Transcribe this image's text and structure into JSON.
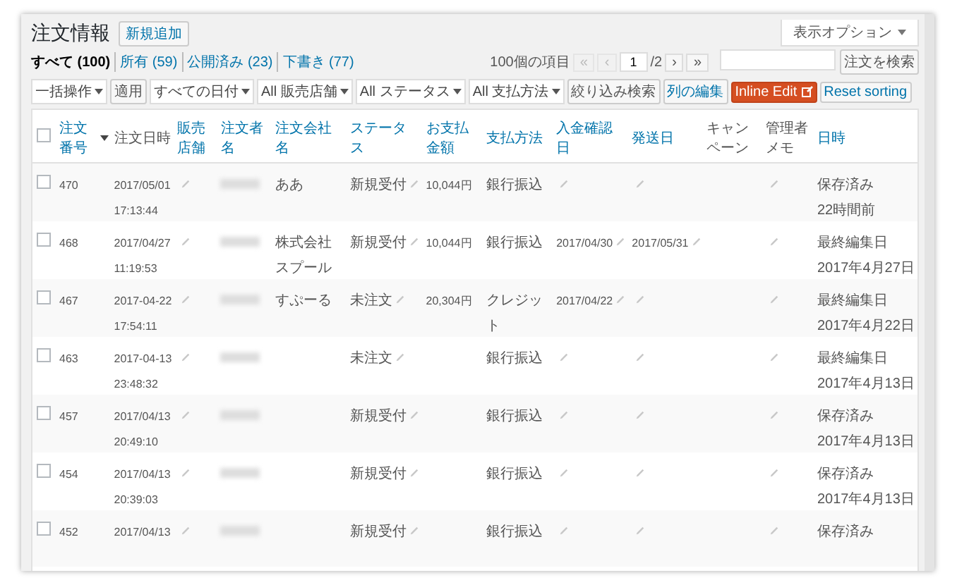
{
  "page": {
    "title": "注文情報",
    "add_new": "新規追加",
    "screen_options": "表示オプション"
  },
  "views": [
    {
      "label": "すべて",
      "count": "(100)",
      "selected": true
    },
    {
      "label": "所有",
      "count": "(59)",
      "selected": false
    },
    {
      "label": "公開済み",
      "count": "(23)",
      "selected": false
    },
    {
      "label": "下書き",
      "count": "(77)",
      "selected": false
    }
  ],
  "search": {
    "button": "注文を検索"
  },
  "toolbar": {
    "bulk_action": "一括操作",
    "apply": "適用",
    "filters": [
      "すべての日付",
      "All 販売店舗",
      "All ステータス",
      "All 支払方法"
    ],
    "filter_button": "絞り込み検索",
    "column_edit": "列の編集",
    "inline_edit": "Inline Edit",
    "reset_sorting": "Reset sorting"
  },
  "pagination": {
    "count": "100個の項目",
    "prev": [
      {
        "label": "«",
        "disabled": true
      },
      {
        "label": "‹",
        "disabled": true
      }
    ],
    "page": "1",
    "total": "/2",
    "next": [
      {
        "label": "›",
        "disabled": false
      },
      {
        "label": "»",
        "disabled": false
      }
    ]
  },
  "table": {
    "select_all_checked": false,
    "columns": [
      {
        "label": "注文番号",
        "sortable": true,
        "sorted": true
      },
      {
        "label": "注文日時",
        "sortable": false,
        "sorted": false
      },
      {
        "label": "販売店舗",
        "sortable": true,
        "sorted": false
      },
      {
        "label": "注文者名",
        "sortable": true,
        "sorted": false
      },
      {
        "label": "注文会社名",
        "sortable": true,
        "sorted": false
      },
      {
        "label": "ステータス",
        "sortable": true,
        "sorted": false
      },
      {
        "label": "お支払金額",
        "sortable": true,
        "sorted": false
      },
      {
        "label": "支払方法",
        "sortable": true,
        "sorted": false
      },
      {
        "label": "入金確認日",
        "sortable": true,
        "sorted": false
      },
      {
        "label": "発送日",
        "sortable": true,
        "sorted": false
      },
      {
        "label": "キャンペーン",
        "sortable": false,
        "sorted": false
      },
      {
        "label": "管理者メモ",
        "sortable": false,
        "sorted": false
      },
      {
        "label": "日時",
        "sortable": true,
        "sorted": false
      }
    ],
    "rows": [
      {
        "checked": false,
        "number": "470",
        "date": "2017/05/01",
        "time": "17:13:44",
        "company": "ああ",
        "status": "新規受付",
        "amount": "10,044円",
        "payment": "銀行振込",
        "state": "保存済み",
        "state_date": "22時間前"
      },
      {
        "checked": false,
        "number": "468",
        "date": "2017/04/27",
        "time": "11:19:53",
        "company": "株式会社スプール",
        "status": "新規受付",
        "amount": "10,044円",
        "payment": "銀行振込",
        "paid_date": "2017/04/30",
        "ship_date": "2017/05/31",
        "state": "最終編集日",
        "state_date": "2017年4月27日"
      },
      {
        "checked": false,
        "number": "467",
        "date": "2017-04-22",
        "time": "17:54:11",
        "company": "すぷーる",
        "status": "未注文",
        "amount": "20,304円",
        "payment": "クレジット",
        "paid_date": "2017/04/22",
        "state": "最終編集日",
        "state_date": "2017年4月22日"
      },
      {
        "checked": false,
        "number": "463",
        "date": "2017-04-13",
        "time": "23:48:32",
        "status": "未注文",
        "payment": "銀行振込",
        "state": "最終編集日",
        "state_date": "2017年4月13日"
      },
      {
        "checked": false,
        "number": "457",
        "date": "2017/04/13",
        "time": "20:49:10",
        "status": "新規受付",
        "payment": "銀行振込",
        "state": "保存済み",
        "state_date": "2017年4月13日"
      },
      {
        "checked": false,
        "number": "454",
        "date": "2017/04/13",
        "time": "20:39:03",
        "status": "新規受付",
        "payment": "銀行振込",
        "state": "保存済み",
        "state_date": "2017年4月13日"
      },
      {
        "checked": false,
        "number": "452",
        "date": "2017/04/13",
        "status": "新規受付",
        "payment": "銀行振込",
        "state": "保存済み"
      }
    ]
  }
}
